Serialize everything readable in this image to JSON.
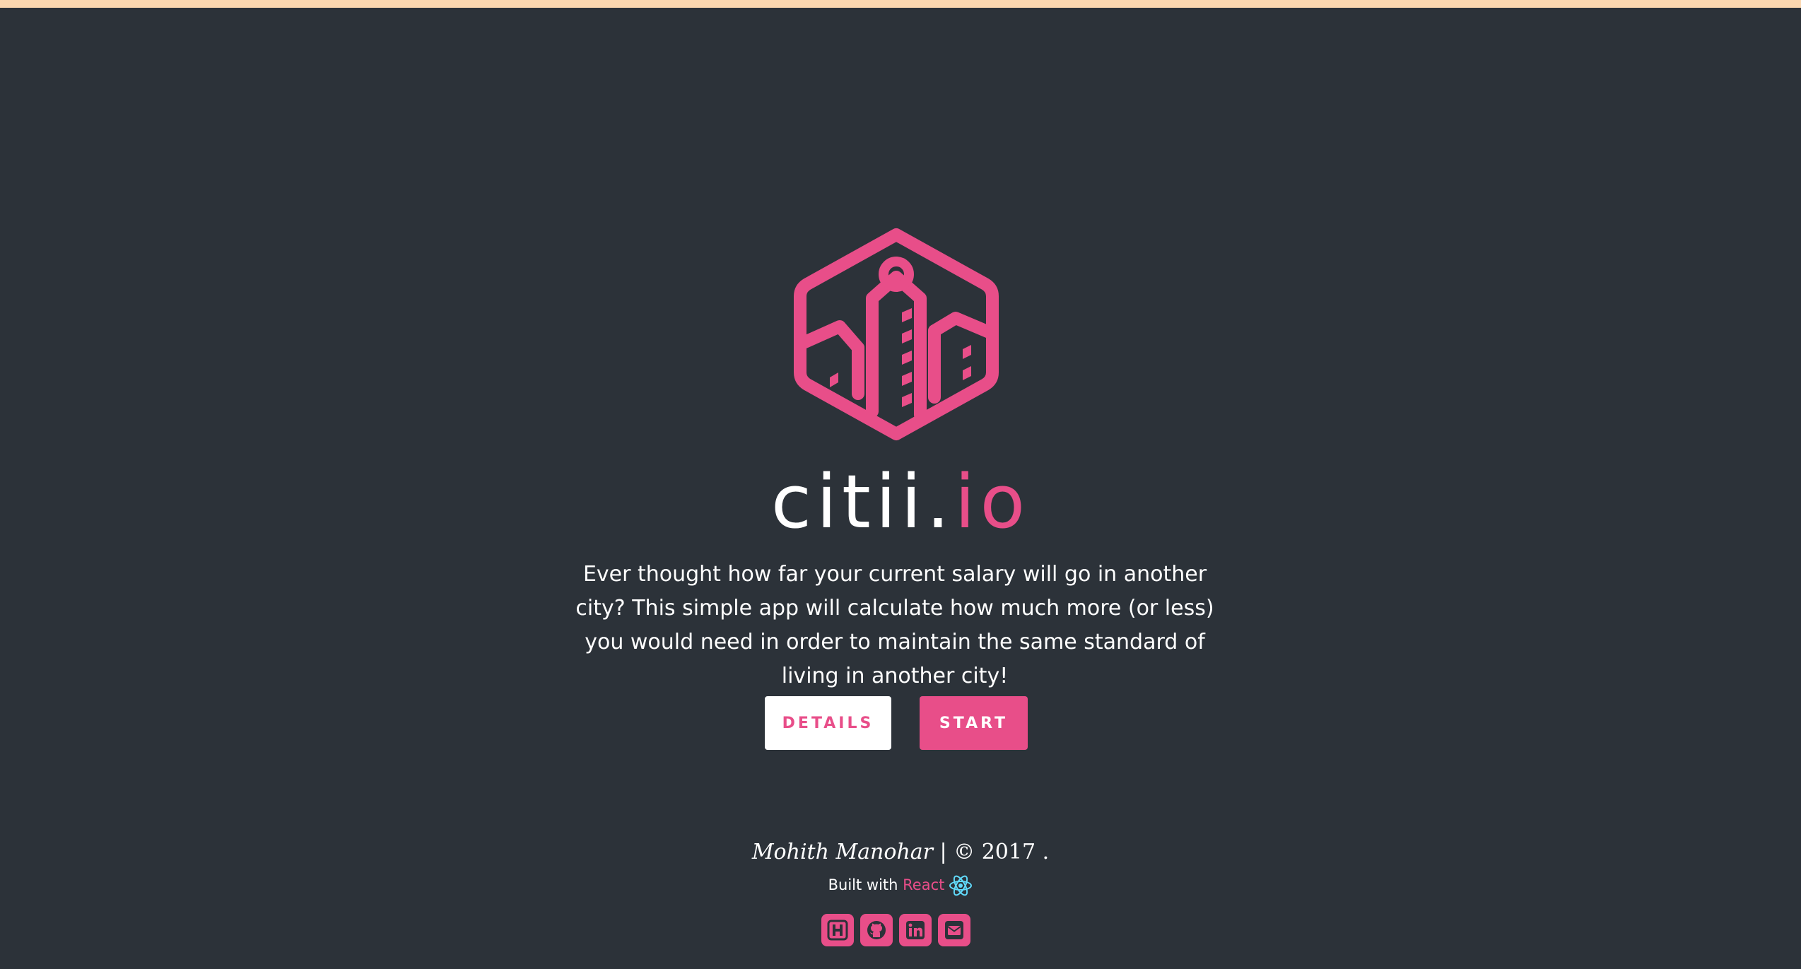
{
  "brand": {
    "name_main": "citii.",
    "name_accent": "io"
  },
  "tagline": "Ever thought how far your current salary will go in another city? This simple app will calculate how much more (or less) you would need in order to maintain the same standard of living in another city!",
  "buttons": {
    "details_label": "DETAILS",
    "start_label": "START"
  },
  "footer": {
    "author": "Mohith Manohar",
    "copyright": " | © 2017 .",
    "built_with": "Built with ",
    "react_label": "React"
  },
  "social_icons": [
    "hashnode-icon",
    "github-icon",
    "linkedin-icon",
    "email-icon"
  ],
  "colors": {
    "background": "#2c3239",
    "accent": "#e84e89",
    "top_strip": "#fbd7b0",
    "react_blue": "#61dafb"
  }
}
